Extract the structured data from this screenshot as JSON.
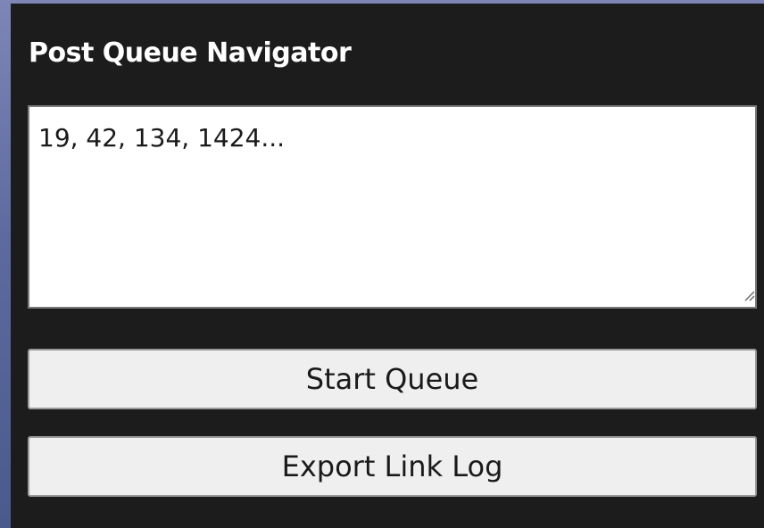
{
  "panel": {
    "title": "Post Queue Navigator",
    "textarea_value": "19, 42, 134, 1424...",
    "buttons": {
      "start_label": "Start Queue",
      "export_label": "Export Link Log"
    }
  },
  "colors": {
    "panel_bg": "#1c1c1c",
    "title_text": "#ffffff",
    "button_bg": "#efefef",
    "input_bg": "#ffffff"
  },
  "icons": {
    "resize_grip": "resize-grip-icon"
  }
}
